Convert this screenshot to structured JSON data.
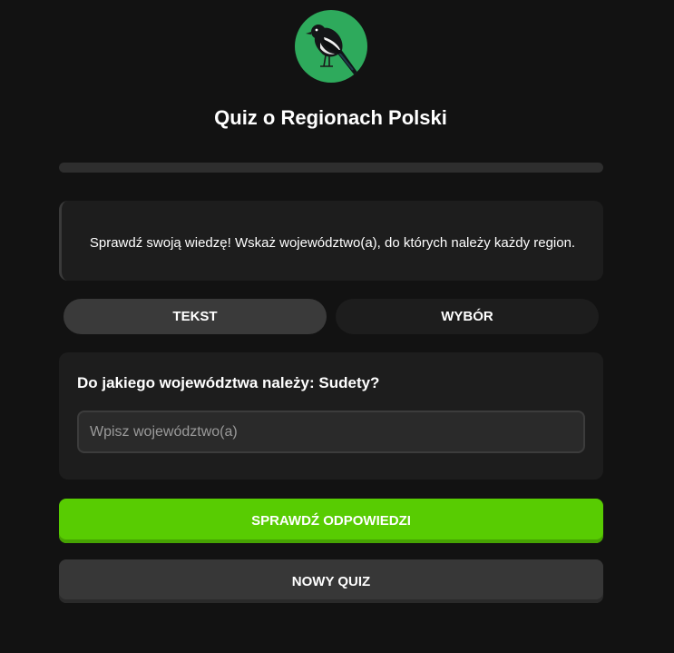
{
  "logo": {
    "icon": "magpie-bird-icon",
    "background": "#2eaa5c"
  },
  "app": {
    "title": "Quiz o Regionach Polski"
  },
  "progress": {
    "value": 0,
    "color": "#58cc02"
  },
  "info": {
    "text": "Sprawdź swoją wiedzę! Wskaż województwo(a), do których należy każdy region."
  },
  "mode": {
    "options": [
      {
        "label": "TEKST",
        "active": true
      },
      {
        "label": "WYBÓR",
        "active": false
      }
    ]
  },
  "question": {
    "text": "Do jakiego województwa należy: Sudety?",
    "input_value": "",
    "input_placeholder": "Wpisz województwo(a)"
  },
  "buttons": {
    "check_label": "SPRAWDŹ ODPOWIEDZI",
    "new_label": "NOWY QUIZ"
  },
  "colors": {
    "accent": "#58cc02",
    "background": "#121212",
    "card": "#1d1d1d"
  }
}
